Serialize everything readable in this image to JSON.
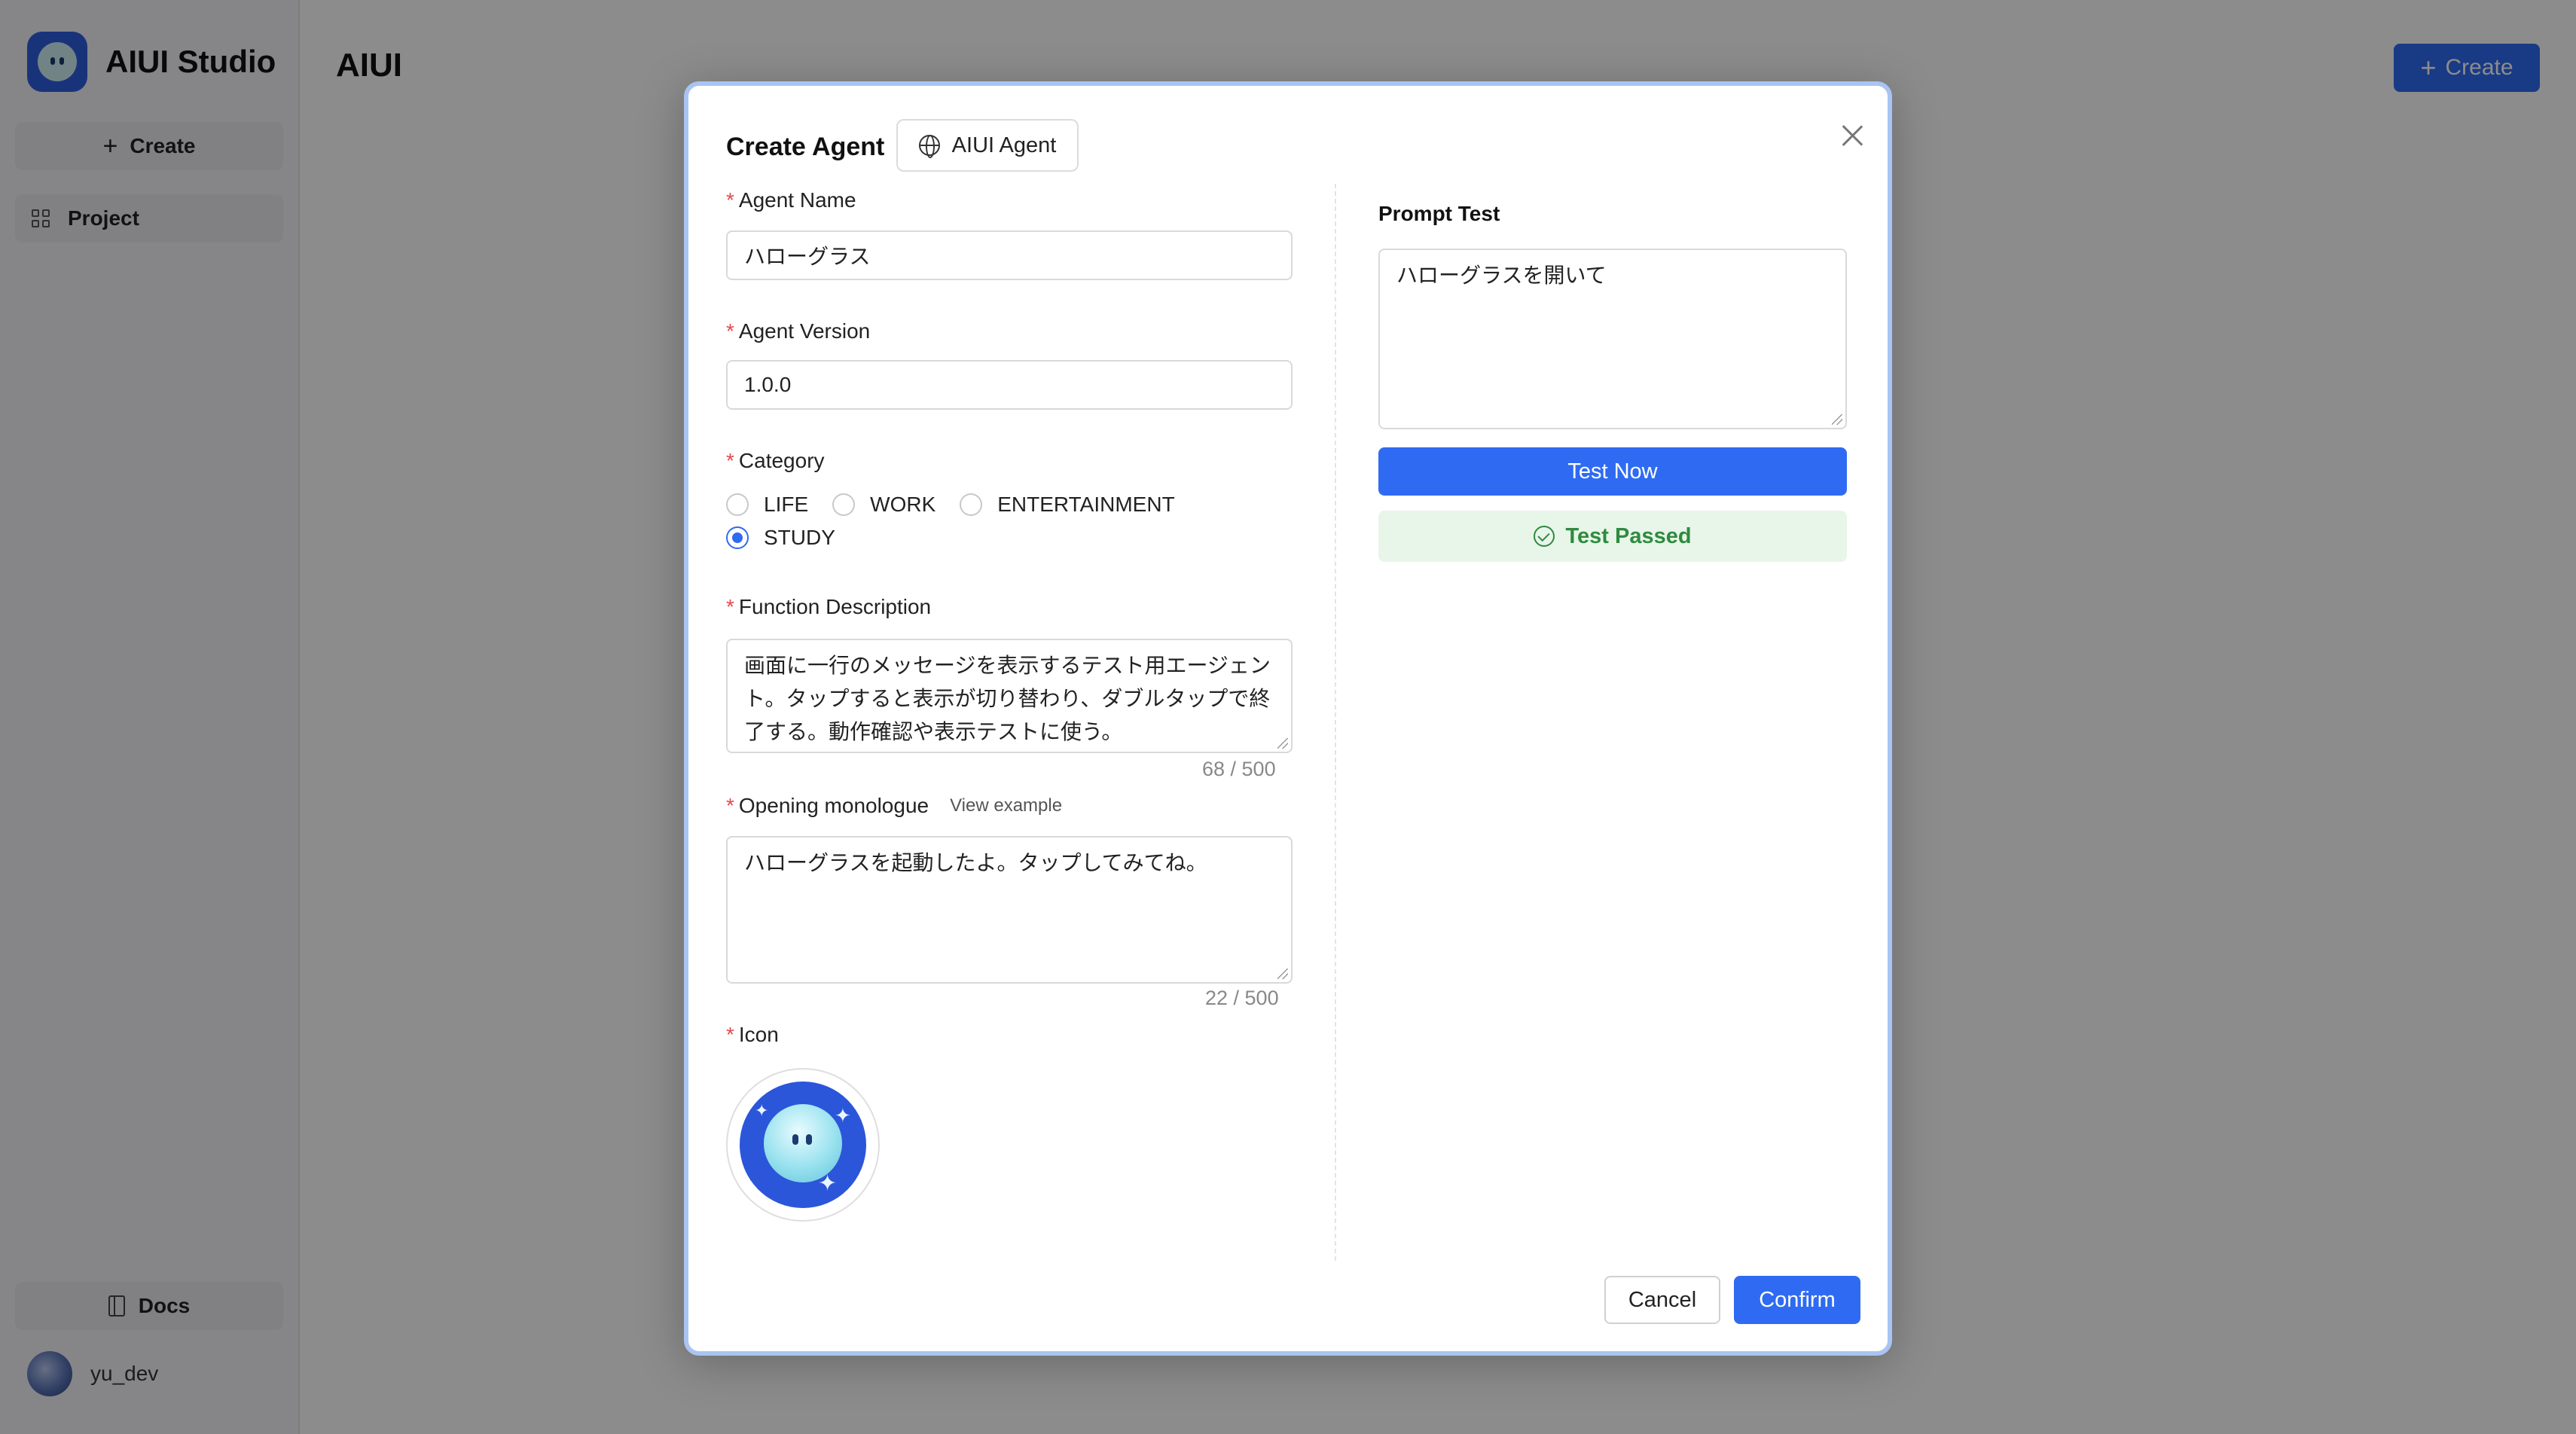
{
  "app": {
    "brand_name": "AIUI Studio",
    "page_title": "AIUI",
    "sidebar": {
      "create_label": "Create",
      "project_label": "Project",
      "docs_label": "Docs",
      "user_name": "yu_dev"
    },
    "top_create_label": "Create"
  },
  "modal": {
    "title": "Create Agent",
    "agent_type_chip": "AIUI Agent",
    "fields": {
      "agent_name": {
        "label": "Agent Name",
        "value": "ハローグラス"
      },
      "agent_version": {
        "label": "Agent Version",
        "value": "1.0.0"
      },
      "category": {
        "label": "Category",
        "options": [
          "LIFE",
          "WORK",
          "ENTERTAINMENT",
          "STUDY"
        ],
        "selected": "STUDY"
      },
      "function_description": {
        "label": "Function Description",
        "value": "画面に一行のメッセージを表示するテスト用エージェント。タップすると表示が切り替わり、ダブルタップで終了する。動作確認や表示テストに使う。",
        "counter": "68 / 500"
      },
      "opening_monologue": {
        "label": "Opening monologue",
        "view_example": "View example",
        "value": "ハローグラスを起動したよ。タップしてみてね。",
        "counter": "22 / 500"
      },
      "icon": {
        "label": "Icon"
      }
    },
    "prompt_test": {
      "title": "Prompt Test",
      "value": "ハローグラスを開いて",
      "test_button": "Test Now",
      "status": "Test Passed"
    },
    "cancel_label": "Cancel",
    "confirm_label": "Confirm"
  },
  "colors": {
    "accent": "#2f6bf2",
    "required": "#e5484d",
    "success": "#2e8b3f",
    "success_bg": "#e8f5e9"
  }
}
